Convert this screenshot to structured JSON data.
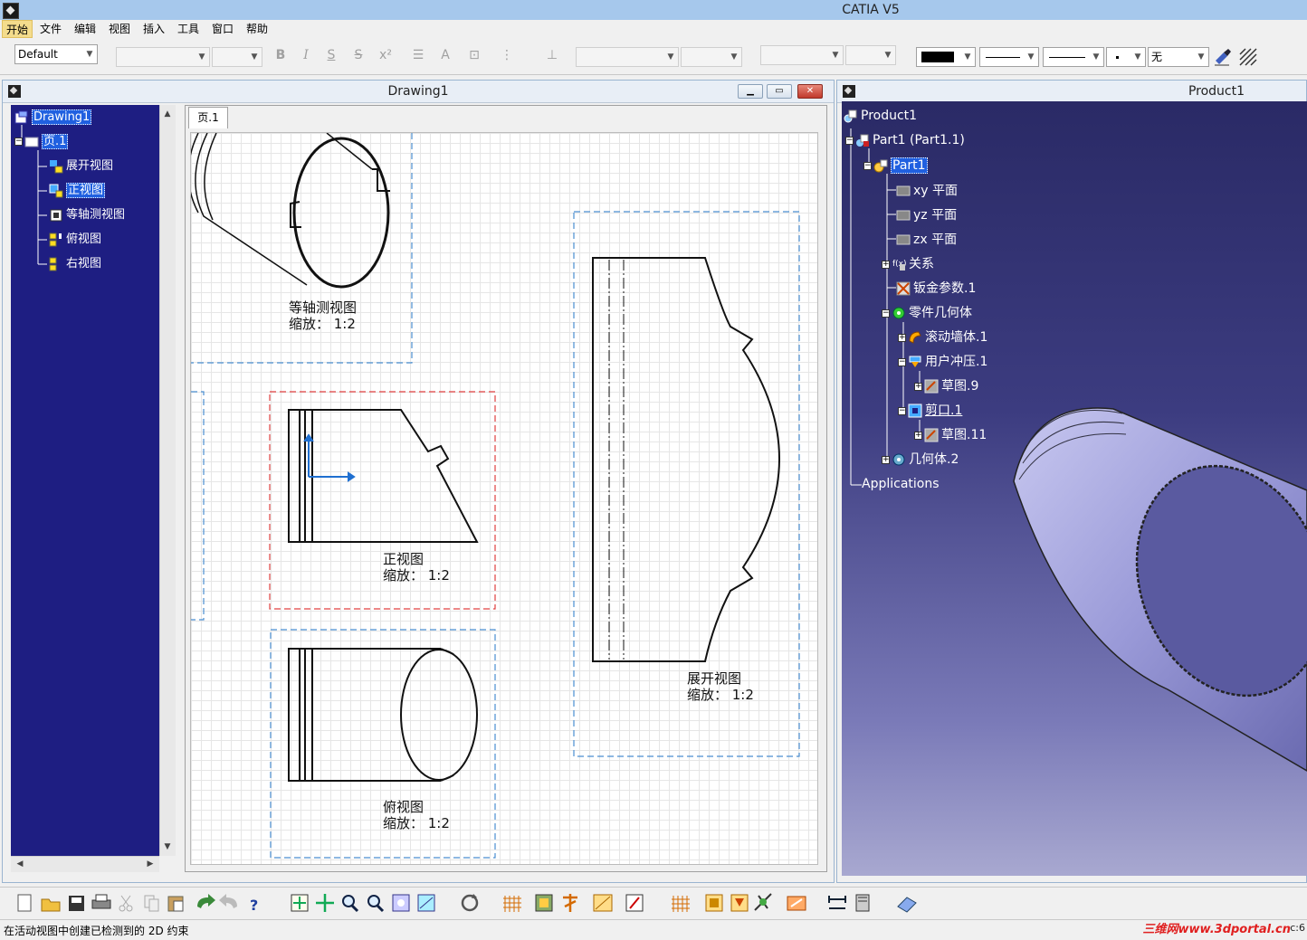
{
  "app": {
    "title": "CATIA V5"
  },
  "menu": [
    "开始",
    "文件",
    "编辑",
    "视图",
    "插入",
    "工具",
    "窗口",
    "帮助"
  ],
  "toolbar1": {
    "style_value": "Default",
    "fill_value": "无"
  },
  "drawing_window": {
    "title": "Drawing1",
    "tree": {
      "root": "Drawing1",
      "page": "页.1",
      "views": [
        "展开视图",
        "正视图",
        "等轴测视图",
        "俯视图",
        "右视图"
      ]
    },
    "sheet_tab": "页.1",
    "captions": {
      "iso": {
        "name": "等轴测视图",
        "scale": "缩放：  1:2"
      },
      "front": {
        "name": "正视图",
        "scale": "缩放：  1:2"
      },
      "top": {
        "name": "俯视图",
        "scale": "缩放：  1:2"
      },
      "unfold": {
        "name": "展开视图",
        "scale": "缩放：  1:2"
      }
    }
  },
  "product_window": {
    "title": "Product1",
    "tree": {
      "product": "Product1",
      "part_instance": "Part1 (Part1.1)",
      "part": "Part1",
      "planes": [
        "xy 平面",
        "yz 平面",
        "zx 平面"
      ],
      "relations": "关系",
      "sheetmetal_params": "钣金参数.1",
      "part_body": "零件几何体",
      "rolled_wall": "滚动墙体.1",
      "user_stamp": "用户冲压.1",
      "sketch9": "草图.9",
      "cutout": "剪口.1",
      "sketch11": "草图.11",
      "geo_set": "几何体.2",
      "applications": "Applications"
    }
  },
  "status": {
    "message": "在活动视图中创建已检测到的 2D 约束"
  },
  "watermark": "三维网www.3dportal.cn",
  "corner": "c:6"
}
